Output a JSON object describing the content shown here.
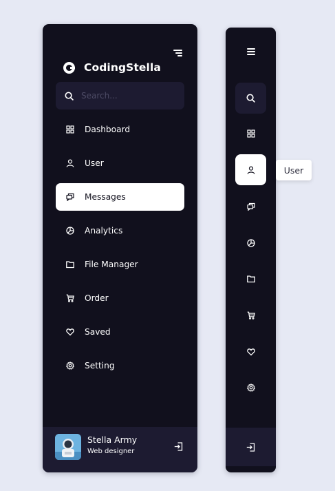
{
  "brand": {
    "name": "CodingStella",
    "logo_icon": "codingstella-logo-icon"
  },
  "colors": {
    "sidebar_bg": "#11101d",
    "surface": "#1d1b31",
    "page_bg": "#e6e9f4",
    "active_bg": "#ffffff"
  },
  "search": {
    "placeholder": "Search..."
  },
  "nav": {
    "items": [
      {
        "label": "Dashboard",
        "icon": "grid-icon",
        "active": false
      },
      {
        "label": "User",
        "icon": "user-icon",
        "active": false
      },
      {
        "label": "Messages",
        "icon": "chat-icon",
        "active": true
      },
      {
        "label": "Analytics",
        "icon": "pie-chart-icon",
        "active": false
      },
      {
        "label": "File Manager",
        "icon": "folder-icon",
        "active": false
      },
      {
        "label": "Order",
        "icon": "cart-icon",
        "active": false
      },
      {
        "label": "Saved",
        "icon": "heart-icon",
        "active": false
      },
      {
        "label": "Setting",
        "icon": "gear-icon",
        "active": false
      }
    ]
  },
  "profile": {
    "name": "Stella Army",
    "role": "Web designer"
  },
  "mini": {
    "active_item": "User",
    "tooltip": "User"
  }
}
